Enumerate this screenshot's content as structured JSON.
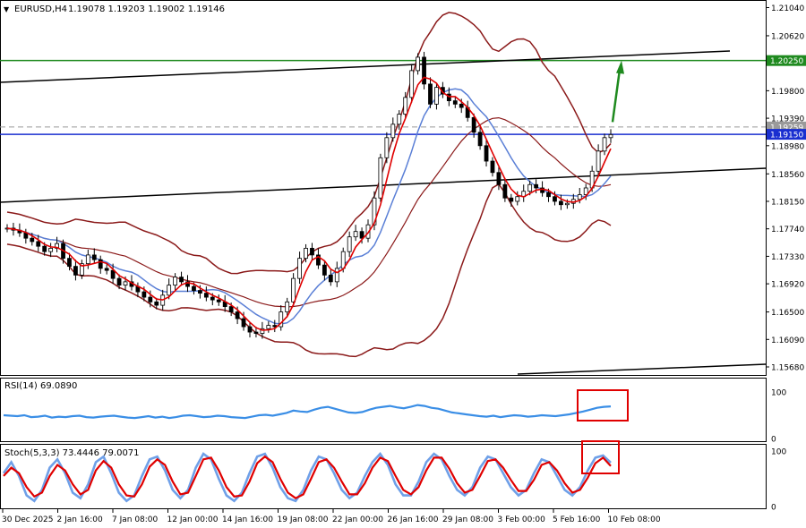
{
  "header": {
    "symbol": "EURUSD,H4",
    "ohlc": "1.19078 1.19203 1.19002 1.19146"
  },
  "colors": {
    "candle": "#000000",
    "bollinger": "#8b1a1a",
    "fast_ma": "#e00000",
    "slow_ma": "#5a7fd6",
    "resistance_line": "#1f8a1f",
    "support_line": "#1a2fd0",
    "trendline": "#000000",
    "rsi_line": "#3a8ee6",
    "stoch_main": "#6fa0e8",
    "stoch_signal": "#e00000",
    "highlight_box": "#e00000",
    "arrow": "#1f8a1f"
  },
  "chart_data": [
    {
      "type": "candlestick",
      "title": "EURUSD,H4",
      "y_ticks": [
        "1.21040",
        "1.20620",
        "1.20250",
        "1.19800",
        "1.19390",
        "1.19259",
        "1.19150",
        "1.18980",
        "1.18560",
        "1.18150",
        "1.17740",
        "1.17330",
        "1.16920",
        "1.16500",
        "1.16090",
        "1.15680"
      ],
      "ylim": [
        1.156,
        1.211
      ],
      "x_ticks": [
        "30 Dec 2025",
        "2 Jan 16:00",
        "7 Jan 08:00",
        "12 Jan 00:00",
        "14 Jan 16:00",
        "19 Jan 08:00",
        "22 Jan 00:00",
        "26 Jan 16:00",
        "29 Jan 08:00",
        "3 Feb 00:00",
        "5 Feb 16:00",
        "10 Feb 08:00"
      ],
      "price_labels": [
        {
          "label": "1.20250",
          "value": 1.2025,
          "color": "#1f8a1f"
        },
        {
          "label": "1.19259",
          "value": 1.19259,
          "color": "#9a9a9a"
        },
        {
          "label": "1.19150",
          "value": 1.1915,
          "color": "#1a2fd0"
        }
      ],
      "horizontal_levels": {
        "resistance": 1.2025,
        "support": 1.1915,
        "current": 1.19259
      },
      "close_series": [
        1.1775,
        1.1772,
        1.1768,
        1.176,
        1.1755,
        1.1748,
        1.174,
        1.1745,
        1.1752,
        1.173,
        1.1718,
        1.1705,
        1.1722,
        1.1735,
        1.1728,
        1.1715,
        1.1712,
        1.17,
        1.169,
        1.1695,
        1.1688,
        1.168,
        1.1672,
        1.1665,
        1.166,
        1.1675,
        1.169,
        1.1702,
        1.1695,
        1.1688,
        1.1682,
        1.1678,
        1.1672,
        1.1668,
        1.1665,
        1.1658,
        1.165,
        1.164,
        1.1628,
        1.162,
        1.1618,
        1.1625,
        1.163,
        1.1628,
        1.165,
        1.1665,
        1.17,
        1.173,
        1.1745,
        1.1735,
        1.172,
        1.1705,
        1.1695,
        1.1715,
        1.174,
        1.1762,
        1.177,
        1.176,
        1.178,
        1.182,
        1.188,
        1.191,
        1.193,
        1.1945,
        1.197,
        1.201,
        1.203,
        1.199,
        1.196,
        1.1985,
        1.1975,
        1.1965,
        1.196,
        1.1955,
        1.194,
        1.1918,
        1.1898,
        1.1875,
        1.1858,
        1.184,
        1.182,
        1.1815,
        1.1822,
        1.183,
        1.184,
        1.1835,
        1.1828,
        1.1822,
        1.1815,
        1.181,
        1.1812,
        1.1818,
        1.1825,
        1.1835,
        1.186,
        1.189,
        1.191,
        1.19146
      ]
    },
    {
      "type": "line",
      "title": "RSI(14) 69.0890",
      "label": "RSI(14)",
      "value": "69.0890",
      "ylim": [
        0,
        100
      ],
      "y_ticks": [
        "100",
        "0"
      ],
      "values": [
        50,
        49,
        48,
        50,
        46,
        47,
        49,
        45,
        47,
        46,
        48,
        49,
        46,
        45,
        47,
        48,
        49,
        47,
        45,
        44,
        46,
        48,
        45,
        47,
        44,
        46,
        49,
        50,
        48,
        46,
        47,
        49,
        48,
        46,
        45,
        44,
        47,
        50,
        51,
        49,
        52,
        55,
        60,
        58,
        57,
        62,
        66,
        68,
        64,
        60,
        56,
        55,
        57,
        62,
        66,
        68,
        70,
        67,
        65,
        68,
        72,
        70,
        66,
        64,
        60,
        56,
        54,
        52,
        50,
        48,
        47,
        49,
        46,
        48,
        50,
        49,
        47,
        48,
        50,
        49,
        48,
        50,
        52,
        55,
        58,
        62,
        66,
        68,
        69
      ]
    },
    {
      "type": "line",
      "title": "Stoch(5,3,3) 73.4446 79.0071",
      "label": "Stoch(5,3,3)",
      "values_text": [
        "73.4446",
        "79.0071"
      ],
      "ylim": [
        0,
        100
      ],
      "y_ticks": [
        "100",
        "0"
      ],
      "series": [
        {
          "values": [
            60,
            80,
            55,
            20,
            10,
            30,
            70,
            85,
            60,
            25,
            15,
            40,
            80,
            90,
            60,
            25,
            10,
            20,
            55,
            85,
            90,
            65,
            30,
            15,
            30,
            70,
            95,
            85,
            50,
            20,
            10,
            25,
            60,
            90,
            95,
            70,
            35,
            15,
            10,
            30,
            65,
            90,
            85,
            60,
            30,
            15,
            25,
            55,
            80,
            95,
            75,
            40,
            20,
            20,
            45,
            80,
            95,
            85,
            55,
            30,
            20,
            35,
            70,
            90,
            85,
            60,
            35,
            20,
            30,
            60,
            85,
            80,
            55,
            30,
            20,
            35,
            65,
            88,
            92,
            79
          ]
        },
        {
          "values": [
            55,
            70,
            60,
            35,
            18,
            25,
            55,
            75,
            65,
            40,
            22,
            30,
            65,
            82,
            70,
            40,
            20,
            18,
            40,
            72,
            85,
            75,
            45,
            22,
            25,
            55,
            85,
            88,
            65,
            35,
            18,
            20,
            45,
            78,
            90,
            80,
            50,
            25,
            15,
            22,
            50,
            80,
            85,
            70,
            45,
            22,
            22,
            42,
            70,
            88,
            82,
            55,
            30,
            22,
            35,
            65,
            88,
            88,
            68,
            42,
            25,
            30,
            55,
            82,
            85,
            70,
            48,
            28,
            28,
            48,
            75,
            80,
            65,
            42,
            25,
            30,
            52,
            78,
            88,
            73
          ]
        }
      ]
    }
  ]
}
